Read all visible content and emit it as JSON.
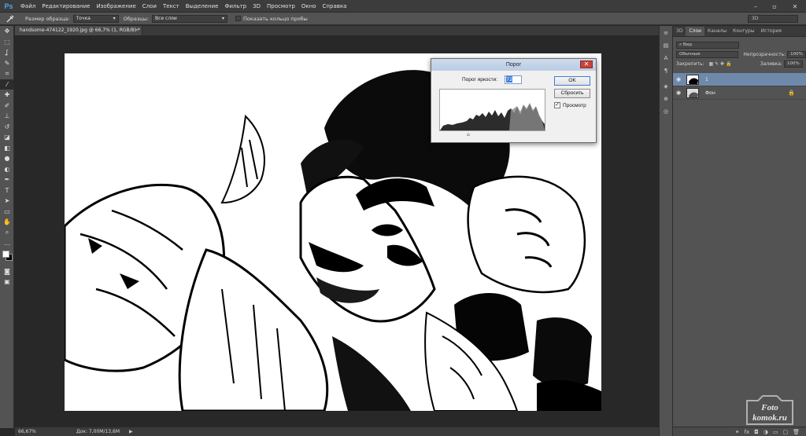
{
  "app": {
    "logo": "Ps"
  },
  "menu": [
    "Файл",
    "Редактирование",
    "Изображение",
    "Слои",
    "Текст",
    "Выделение",
    "Фильтр",
    "3D",
    "Просмотр",
    "Окно",
    "Справка"
  ],
  "options": {
    "sample_size_label": "Размер образца:",
    "sample_size_value": "Точка",
    "samples_label": "Образцы:",
    "samples_value": "Все слои",
    "show_ring_label": "Показать кольцо пробы",
    "workspace_value": "3D"
  },
  "document": {
    "tab_title": "handsome-474122_1920.jpg @ 66,7% (1, RGB/8) *",
    "tab_close": "×"
  },
  "status": {
    "zoom": "66,67%",
    "doc_size": "Док: 7,00M/13,6M",
    "arrow": "▶"
  },
  "panel": {
    "tabs": [
      "3D",
      "Слои",
      "Каналы",
      "Контуры",
      "История"
    ],
    "active_tab": "Слои",
    "kind_label": "Вид",
    "blend_mode": "Обычные",
    "opacity_label": "Непрозрачность:",
    "opacity_value": "100%",
    "lock_label": "Закрепить:",
    "fill_label": "Заливка:",
    "fill_value": "100%",
    "layers": [
      {
        "name": "1",
        "selected": true
      },
      {
        "name": "Фон",
        "selected": false,
        "locked": true
      }
    ]
  },
  "dialog": {
    "title": "Порог",
    "threshold_label": "Порог яркости:",
    "threshold_value": "72",
    "ok_label": "OK",
    "reset_label": "Сбросить",
    "preview_label": "Просмотр",
    "preview_checked": true,
    "histogram_marker": "⌂"
  },
  "watermark": {
    "line1": "Foto",
    "line2": "komok.ru"
  },
  "colors": {
    "selection": "#6f89ab",
    "accent": "#3d7bd6",
    "close_red": "#c7443a"
  }
}
